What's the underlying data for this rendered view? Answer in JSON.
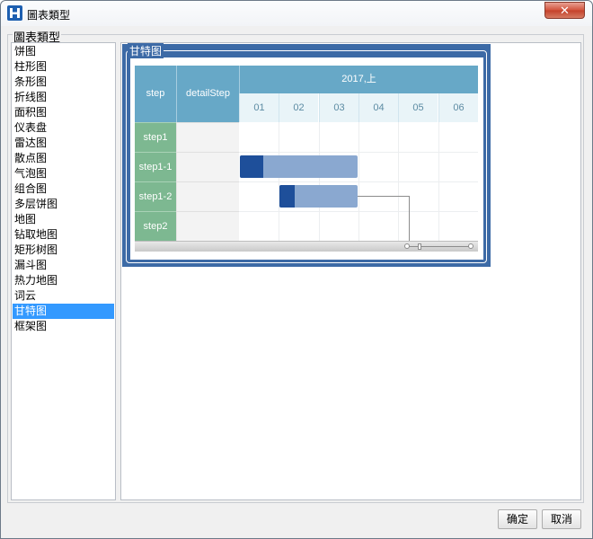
{
  "window": {
    "title": "圖表類型",
    "close_glyph": "✕"
  },
  "group": {
    "legend": "圖表類型"
  },
  "chart_types": {
    "items": [
      "饼图",
      "柱形图",
      "条形图",
      "折线图",
      "面积图",
      "仪表盘",
      "雷达图",
      "散点图",
      "气泡图",
      "组合图",
      "多层饼图",
      "地图",
      "钻取地图",
      "矩形树图",
      "漏斗图",
      "热力地图",
      "词云",
      "甘特图",
      "框架图"
    ],
    "selected": "甘特图"
  },
  "preview": {
    "title": "甘特图",
    "gantt": {
      "header_step": "step",
      "header_detail": "detailStep",
      "period": "2017,上",
      "months": [
        "01",
        "02",
        "03",
        "04",
        "05",
        "06"
      ],
      "rows": [
        {
          "label": "step1",
          "start_month": null,
          "end_month": null,
          "progress": 0
        },
        {
          "label": "step1-1",
          "start_month": 1.0,
          "end_month": 3.0,
          "progress": 0.2
        },
        {
          "label": "step1-2",
          "start_month": 2.0,
          "end_month": 3.0,
          "progress": 0.2
        },
        {
          "label": "step2",
          "start_month": null,
          "end_month": null,
          "progress": 0
        }
      ],
      "colors": {
        "header": "#67a8c7",
        "row_label": "#7db891",
        "bar": "#8aa8d0",
        "bar_progress": "#1e4f9a"
      }
    }
  },
  "buttons": {
    "ok": "确定",
    "cancel": "取消"
  }
}
